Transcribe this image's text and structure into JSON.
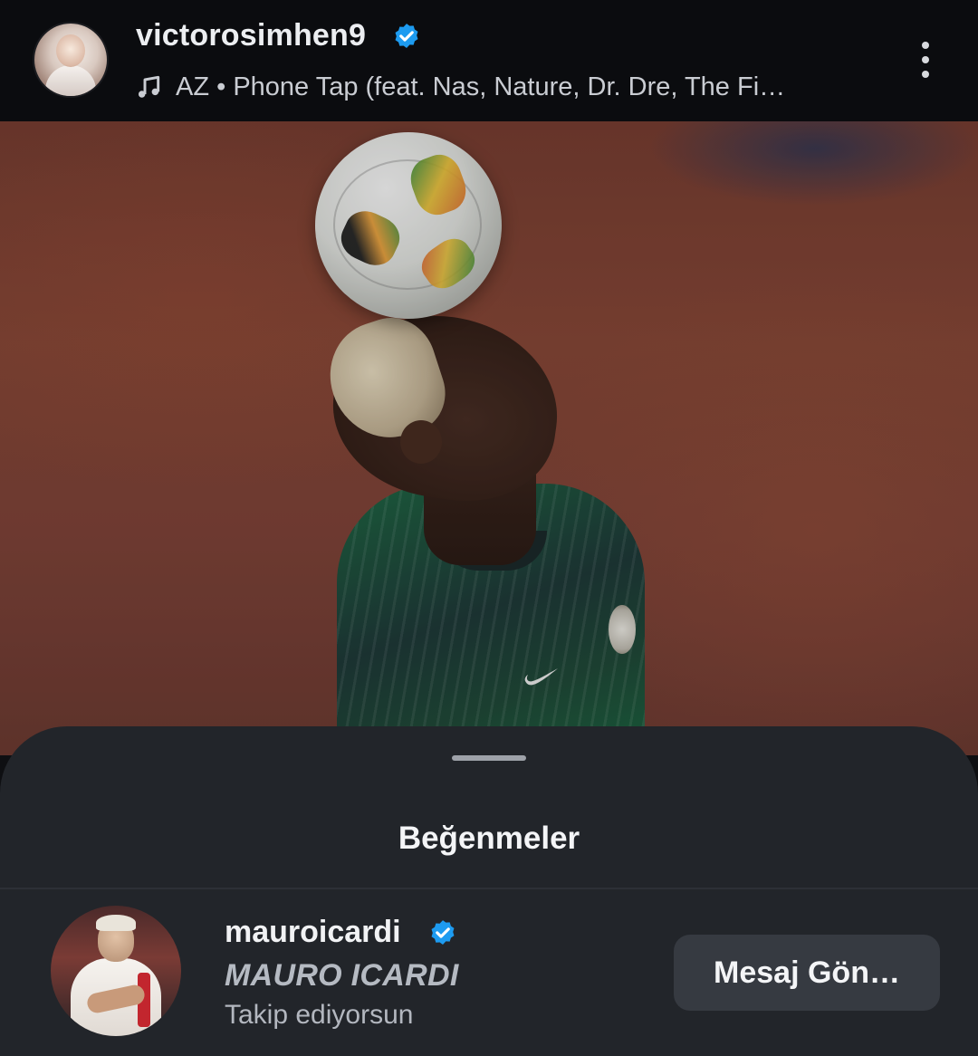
{
  "post": {
    "author": "victorosimhen9",
    "music": "AZ • Phone Tap (feat. Nas, Nature, Dr. Dre, The Fi…"
  },
  "likes_sheet": {
    "title": "Beğenmeler",
    "users": [
      {
        "username": "mauroicardi",
        "full_name": "MAURO ICARDI",
        "status": "Takip ediyorsun",
        "button": "Mesaj Gön…"
      }
    ]
  },
  "colors": {
    "verified": "#1d9bf0",
    "sheet_bg": "#22252a",
    "button_bg": "#363a41"
  },
  "icons": [
    "verified-badge-icon",
    "music-note-icon",
    "more-options-icon"
  ]
}
